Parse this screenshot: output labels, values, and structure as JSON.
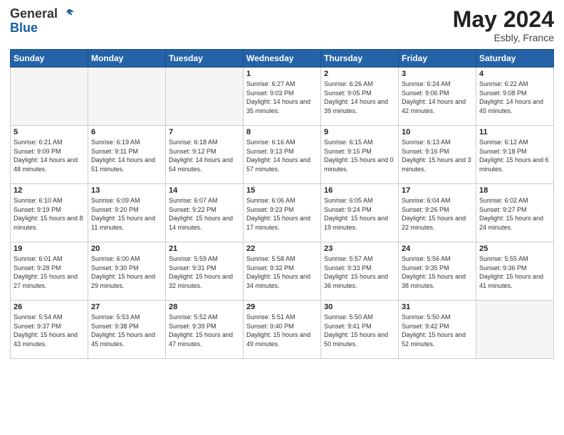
{
  "header": {
    "logo_line1": "General",
    "logo_line2": "Blue",
    "month_year": "May 2024",
    "location": "Esbly, France"
  },
  "weekdays": [
    "Sunday",
    "Monday",
    "Tuesday",
    "Wednesday",
    "Thursday",
    "Friday",
    "Saturday"
  ],
  "weeks": [
    [
      {
        "day": "",
        "info": "",
        "empty": true
      },
      {
        "day": "",
        "info": "",
        "empty": true
      },
      {
        "day": "",
        "info": "",
        "empty": true
      },
      {
        "day": "1",
        "info": "Sunrise: 6:27 AM\nSunset: 9:03 PM\nDaylight: 14 hours\nand 35 minutes."
      },
      {
        "day": "2",
        "info": "Sunrise: 6:26 AM\nSunset: 9:05 PM\nDaylight: 14 hours\nand 39 minutes."
      },
      {
        "day": "3",
        "info": "Sunrise: 6:24 AM\nSunset: 9:06 PM\nDaylight: 14 hours\nand 42 minutes."
      },
      {
        "day": "4",
        "info": "Sunrise: 6:22 AM\nSunset: 9:08 PM\nDaylight: 14 hours\nand 45 minutes."
      }
    ],
    [
      {
        "day": "5",
        "info": "Sunrise: 6:21 AM\nSunset: 9:09 PM\nDaylight: 14 hours\nand 48 minutes."
      },
      {
        "day": "6",
        "info": "Sunrise: 6:19 AM\nSunset: 9:11 PM\nDaylight: 14 hours\nand 51 minutes."
      },
      {
        "day": "7",
        "info": "Sunrise: 6:18 AM\nSunset: 9:12 PM\nDaylight: 14 hours\nand 54 minutes."
      },
      {
        "day": "8",
        "info": "Sunrise: 6:16 AM\nSunset: 9:13 PM\nDaylight: 14 hours\nand 57 minutes."
      },
      {
        "day": "9",
        "info": "Sunrise: 6:15 AM\nSunset: 9:15 PM\nDaylight: 15 hours\nand 0 minutes."
      },
      {
        "day": "10",
        "info": "Sunrise: 6:13 AM\nSunset: 9:16 PM\nDaylight: 15 hours\nand 3 minutes."
      },
      {
        "day": "11",
        "info": "Sunrise: 6:12 AM\nSunset: 9:18 PM\nDaylight: 15 hours\nand 6 minutes."
      }
    ],
    [
      {
        "day": "12",
        "info": "Sunrise: 6:10 AM\nSunset: 9:19 PM\nDaylight: 15 hours\nand 8 minutes."
      },
      {
        "day": "13",
        "info": "Sunrise: 6:09 AM\nSunset: 9:20 PM\nDaylight: 15 hours\nand 11 minutes."
      },
      {
        "day": "14",
        "info": "Sunrise: 6:07 AM\nSunset: 9:22 PM\nDaylight: 15 hours\nand 14 minutes."
      },
      {
        "day": "15",
        "info": "Sunrise: 6:06 AM\nSunset: 9:23 PM\nDaylight: 15 hours\nand 17 minutes."
      },
      {
        "day": "16",
        "info": "Sunrise: 6:05 AM\nSunset: 9:24 PM\nDaylight: 15 hours\nand 19 minutes."
      },
      {
        "day": "17",
        "info": "Sunrise: 6:04 AM\nSunset: 9:26 PM\nDaylight: 15 hours\nand 22 minutes."
      },
      {
        "day": "18",
        "info": "Sunrise: 6:02 AM\nSunset: 9:27 PM\nDaylight: 15 hours\nand 24 minutes."
      }
    ],
    [
      {
        "day": "19",
        "info": "Sunrise: 6:01 AM\nSunset: 9:28 PM\nDaylight: 15 hours\nand 27 minutes."
      },
      {
        "day": "20",
        "info": "Sunrise: 6:00 AM\nSunset: 9:30 PM\nDaylight: 15 hours\nand 29 minutes."
      },
      {
        "day": "21",
        "info": "Sunrise: 5:59 AM\nSunset: 9:31 PM\nDaylight: 15 hours\nand 32 minutes."
      },
      {
        "day": "22",
        "info": "Sunrise: 5:58 AM\nSunset: 9:32 PM\nDaylight: 15 hours\nand 34 minutes."
      },
      {
        "day": "23",
        "info": "Sunrise: 5:57 AM\nSunset: 9:33 PM\nDaylight: 15 hours\nand 36 minutes."
      },
      {
        "day": "24",
        "info": "Sunrise: 5:56 AM\nSunset: 9:35 PM\nDaylight: 15 hours\nand 38 minutes."
      },
      {
        "day": "25",
        "info": "Sunrise: 5:55 AM\nSunset: 9:36 PM\nDaylight: 15 hours\nand 41 minutes."
      }
    ],
    [
      {
        "day": "26",
        "info": "Sunrise: 5:54 AM\nSunset: 9:37 PM\nDaylight: 15 hours\nand 43 minutes."
      },
      {
        "day": "27",
        "info": "Sunrise: 5:53 AM\nSunset: 9:38 PM\nDaylight: 15 hours\nand 45 minutes."
      },
      {
        "day": "28",
        "info": "Sunrise: 5:52 AM\nSunset: 9:39 PM\nDaylight: 15 hours\nand 47 minutes."
      },
      {
        "day": "29",
        "info": "Sunrise: 5:51 AM\nSunset: 9:40 PM\nDaylight: 15 hours\nand 49 minutes."
      },
      {
        "day": "30",
        "info": "Sunrise: 5:50 AM\nSunset: 9:41 PM\nDaylight: 15 hours\nand 50 minutes."
      },
      {
        "day": "31",
        "info": "Sunrise: 5:50 AM\nSunset: 9:42 PM\nDaylight: 15 hours\nand 52 minutes."
      },
      {
        "day": "",
        "info": "",
        "empty": true
      }
    ]
  ]
}
